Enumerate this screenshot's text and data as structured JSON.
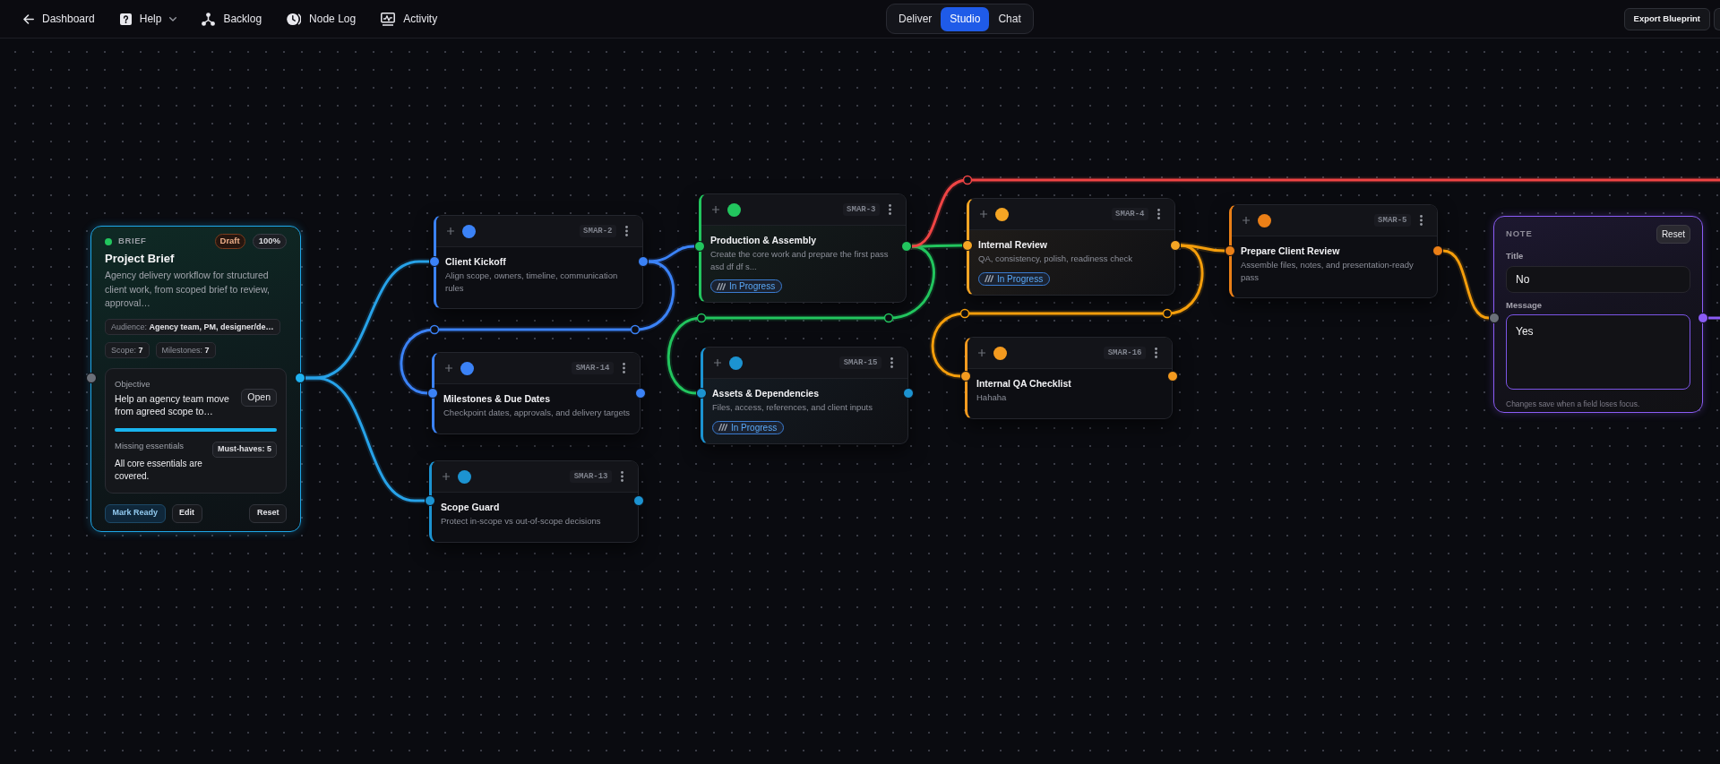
{
  "toolbar": {
    "links": [
      {
        "label": "Dashboard",
        "kind": "link"
      },
      {
        "label": "Help",
        "kind": "menu"
      },
      {
        "label": "Backlog",
        "kind": "link"
      },
      {
        "label": "Node Log",
        "kind": "link"
      },
      {
        "label": "Activity",
        "kind": "link"
      }
    ],
    "modes": [
      {
        "label": "Deliver",
        "selected": false
      },
      {
        "label": "Studio",
        "selected": true
      },
      {
        "label": "Chat",
        "selected": false
      }
    ],
    "actions": [
      {
        "label": "Export Blueprint"
      }
    ]
  },
  "brief": {
    "tag": "BRIEF",
    "badges": [
      {
        "label": "Draft",
        "kind": "status"
      },
      {
        "label": "100%",
        "kind": "progress"
      }
    ],
    "title": "Project Brief",
    "description": "Agency delivery workflow for structured client work, from scoped brief to review, approval…",
    "tags": [
      {
        "text": "Audience: **Agency team, PM, designer/de…**"
      },
      {
        "text": "Scope: **7**"
      },
      {
        "text": "Milestones: **7**"
      }
    ],
    "objective": {
      "label": "Objective",
      "text": "Help an agency team move from agreed scope to…",
      "button": "Open",
      "level": 1
    },
    "essentials": {
      "label": "Missing essentials",
      "tag": "Must-haves: 5",
      "text": "All core essentials are covered."
    },
    "actions": [
      {
        "label": "Mark Ready",
        "kind": "primary"
      },
      {
        "label": "Edit",
        "kind": "secondary"
      },
      {
        "label": "Reset",
        "kind": "secondary"
      }
    ]
  },
  "nodes": [
    {
      "code": "SMAR-2",
      "title": "Client Kickoff",
      "description": "Align scope, owners, timeline, communication rules",
      "color": "#3b82f6"
    },
    {
      "code": "SMAR-14",
      "title": "Milestones & Due Dates",
      "description": "Checkpoint dates, approvals, and delivery targets",
      "color": "#3b82f6"
    },
    {
      "code": "SMAR-13",
      "title": "Scope Guard",
      "description": "Protect in-scope vs out-of-scope decisions",
      "color": "#1c93d1"
    },
    {
      "code": "SMAR-3",
      "title": "Production & Assembly",
      "description": "Create the core work and prepare the first pass asd df df s...",
      "color": "#22c55e",
      "status": "In Progress"
    },
    {
      "code": "SMAR-15",
      "title": "Assets & Dependencies",
      "description": "Files, access, references, and client inputs",
      "color": "#1c93d1",
      "status": "In Progress"
    },
    {
      "code": "SMAR-4",
      "title": "Internal Review",
      "description": "QA, consistency, polish, readiness check",
      "color": "#f5a524",
      "status": "In Progress"
    },
    {
      "code": "SMAR-16",
      "title": "Internal QA Checklist",
      "description": "Hahaha",
      "color": "#f39a1f"
    },
    {
      "code": "SMAR-5",
      "title": "Prepare Client Review",
      "description": "Assemble files, notes, and presentation-ready pass",
      "color": "#ea7f17"
    }
  ],
  "note": {
    "tag": "NOTE",
    "button": "Reset",
    "fields": [
      {
        "label": "Title",
        "value": "No",
        "kind": "input",
        "focused": false
      },
      {
        "label": "Message",
        "value": "Yes",
        "kind": "textarea",
        "focused": true
      }
    ],
    "hint": "Changes save when a field loses focus."
  },
  "edges": [
    {
      "color": "#27a2e8"
    },
    {
      "color": "#27a2e8"
    },
    {
      "color": "#3b82f6"
    },
    {
      "color": "#3b82f6"
    },
    {
      "color": "#22c55e"
    },
    {
      "color": "#22c55e"
    },
    {
      "color": "#ef4444"
    },
    {
      "color": "#f59e0b"
    },
    {
      "color": "#f59e0b"
    },
    {
      "color": "#f59e0b"
    },
    {
      "color": "#8b5cf6"
    }
  ]
}
